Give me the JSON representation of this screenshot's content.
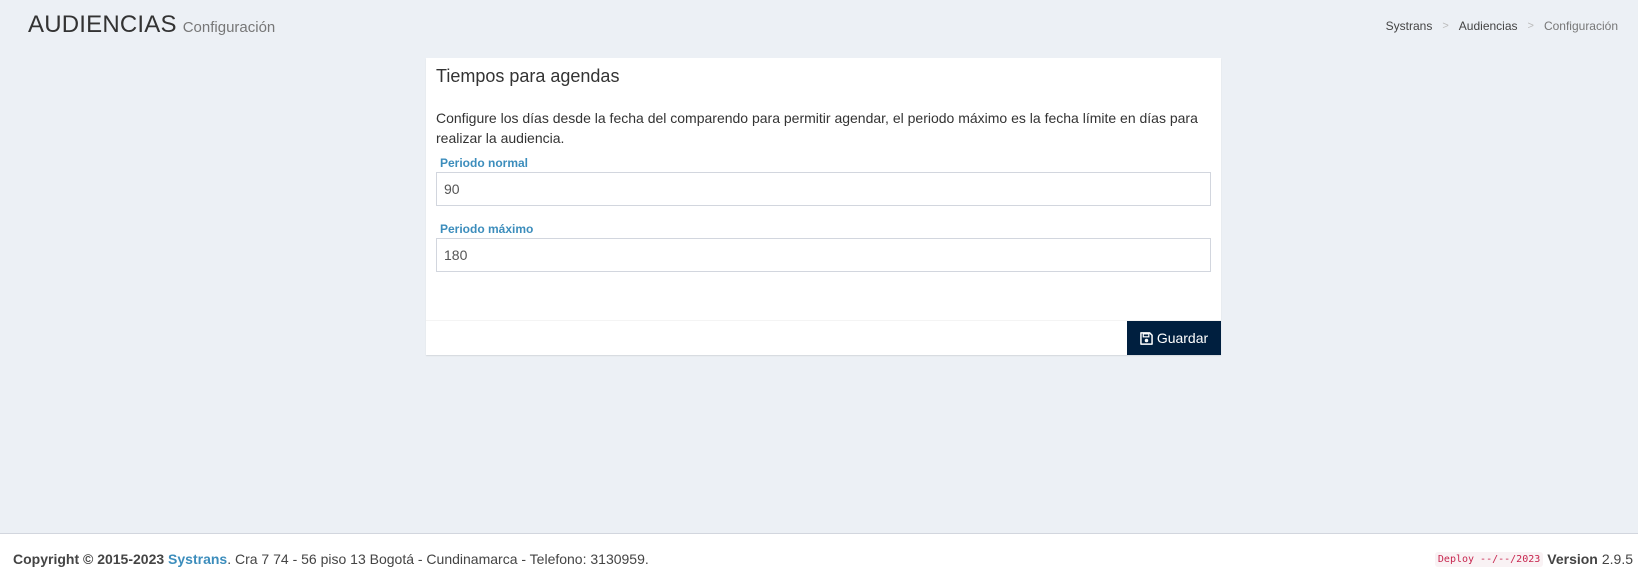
{
  "header": {
    "title": "AUDIENCIAS",
    "subtitle": "Configuración"
  },
  "breadcrumb": {
    "items": [
      "Systrans",
      "Audiencias",
      "Configuración"
    ],
    "separator": ">"
  },
  "panel": {
    "title": "Tiempos para agendas",
    "description": "Configure los días desde la fecha del comparendo para permitir agendar, el periodo máximo es la fecha límite en días para realizar la audiencia.",
    "fields": [
      {
        "label": "Periodo normal",
        "value": "90"
      },
      {
        "label": "Periodo máximo",
        "value": "180"
      }
    ],
    "save_button": {
      "label": "Guardar",
      "icon": "floppy-disk-icon"
    }
  },
  "footer": {
    "copyright": "Copyright © 2015-2023",
    "company": "Systrans",
    "address": ". Cra 7 74 - 56 piso 13 Bogotá - Cundinamarca - Telefono: 3130959.",
    "deploy": "Deploy --/--/2023",
    "version_label": "Version",
    "version_number": "2.9.5"
  },
  "colors": {
    "background": "#ecf0f5",
    "label_accent": "#3c8dbc",
    "button_bg": "#001f3f",
    "deploy_code": "#c7254e"
  }
}
